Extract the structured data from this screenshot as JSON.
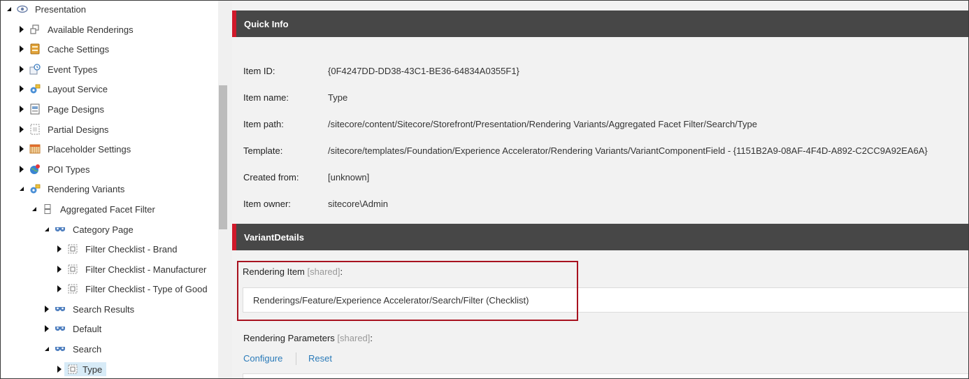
{
  "tree": {
    "items": [
      {
        "label": "Presentation",
        "state": "expanded",
        "icon": "eye-icon"
      },
      {
        "label": "Available Renderings",
        "state": "collapsed",
        "icon": "renderings-icon"
      },
      {
        "label": "Cache Settings",
        "state": "collapsed",
        "icon": "cache-icon"
      },
      {
        "label": "Event Types",
        "state": "collapsed",
        "icon": "event-types-icon"
      },
      {
        "label": "Layout Service",
        "state": "collapsed",
        "icon": "layout-service-icon"
      },
      {
        "label": "Page Designs",
        "state": "collapsed",
        "icon": "page-designs-icon"
      },
      {
        "label": "Partial Designs",
        "state": "collapsed",
        "icon": "partial-designs-icon"
      },
      {
        "label": "Placeholder Settings",
        "state": "collapsed",
        "icon": "placeholder-icon"
      },
      {
        "label": "POI Types",
        "state": "collapsed",
        "icon": "poi-icon"
      },
      {
        "label": "Rendering Variants",
        "state": "expanded",
        "icon": "rendering-variants-icon"
      },
      {
        "label": "Aggregated Facet Filter",
        "state": "expanded",
        "icon": "variant-folder-icon"
      },
      {
        "label": "Category Page",
        "state": "expanded",
        "icon": "variant-mask-icon"
      },
      {
        "label": "Filter Checklist - Brand",
        "state": "collapsed",
        "icon": "variant-field-icon"
      },
      {
        "label": "Filter Checklist - Manufacturer",
        "state": "collapsed",
        "icon": "variant-field-icon"
      },
      {
        "label": "Filter Checklist - Type of Good",
        "state": "collapsed",
        "icon": "variant-field-icon"
      },
      {
        "label": "Search Results",
        "state": "collapsed",
        "icon": "variant-mask-icon"
      },
      {
        "label": "Default",
        "state": "collapsed",
        "icon": "variant-mask-icon"
      },
      {
        "label": "Search",
        "state": "expanded",
        "icon": "variant-mask-icon"
      },
      {
        "label": "Type",
        "state": "collapsed",
        "icon": "variant-field-icon",
        "selected": true
      }
    ]
  },
  "quick_info": {
    "title": "Quick Info",
    "rows": [
      {
        "label": "Item ID:",
        "value": "{0F4247DD-DD38-43C1-BE36-64834A0355F1}"
      },
      {
        "label": "Item name:",
        "value": "Type"
      },
      {
        "label": "Item path:",
        "value": "/sitecore/content/Sitecore/Storefront/Presentation/Rendering Variants/Aggregated Facet Filter/Search/Type"
      },
      {
        "label": "Template:",
        "value": "/sitecore/templates/Foundation/Experience Accelerator/Rendering Variants/VariantComponentField - {1151B2A9-08AF-4F4D-A892-C2CC9A92EA6A}"
      },
      {
        "label": "Created from:",
        "value": "[unknown]"
      },
      {
        "label": "Item owner:",
        "value": "sitecore\\Admin"
      }
    ]
  },
  "variant_details": {
    "title": "VariantDetails",
    "rendering_item_label": "Rendering Item",
    "rendering_item_shared": "[shared]",
    "label_colon": ":",
    "rendering_item_value": "Renderings/Feature/Experience Accelerator/Search/Filter (Checklist)",
    "rendering_params_label": "Rendering Parameters",
    "rendering_params_shared": "[shared]",
    "configure_link": "Configure",
    "reset_link": "Reset"
  },
  "colors": {
    "header_bg": "#474747",
    "header_accent": "#d0192a",
    "highlight_border": "#a8121f",
    "link": "#2b7bb9",
    "selected_bg": "#d7ebf7"
  }
}
